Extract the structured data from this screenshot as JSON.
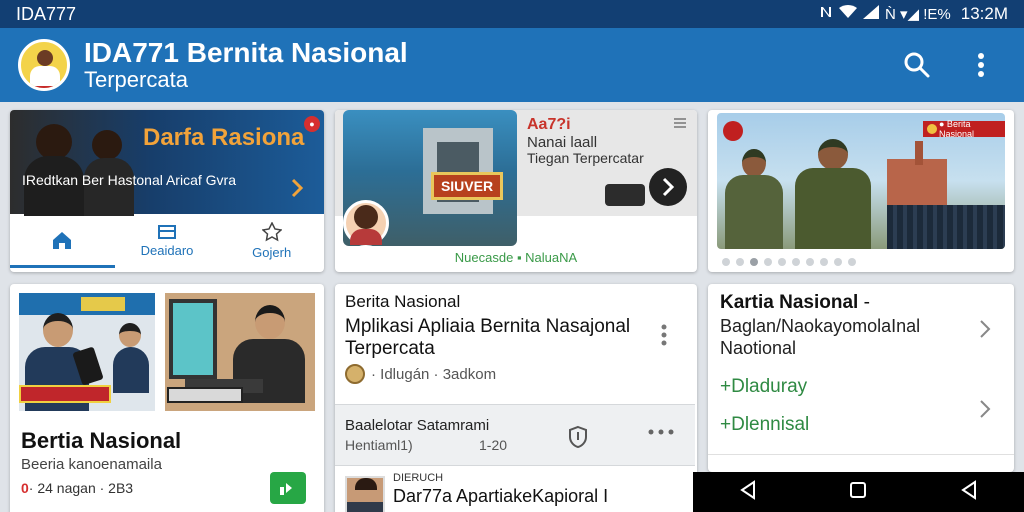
{
  "status_bar": {
    "app_name": "IDA777",
    "indicators": "Ǹ ▾◢ ǃΕ%",
    "time": "13:2M"
  },
  "app_bar": {
    "title": "IDA771 Bernita Nasional",
    "subtitle": "Terpercata",
    "icons": [
      "search-icon",
      "more-vert-icon"
    ]
  },
  "colors": {
    "appbar": "#1f72b8",
    "statusbar": "#123f73",
    "accent_green": "#27a745",
    "accent_red": "#d62f2f",
    "accent_orange": "#f2a33a"
  },
  "card1": {
    "banner_title": "Darfa Rasiona",
    "banner_text": "IRedtkan Ber Hastonal Aricaf Gvra",
    "badge": "●",
    "tabs": [
      {
        "label": "",
        "icon": "home-icon",
        "active": true
      },
      {
        "label": "Deaidaro",
        "icon": "news-icon",
        "active": false
      },
      {
        "label": "Gojerh",
        "icon": "star-icon",
        "active": false
      }
    ]
  },
  "card2": {
    "tag": "Aa7?i",
    "line1": "Nanai laall",
    "line2": "Tiegan Terpercatar",
    "sign": "SIUVER",
    "caption": "Nuecasde ▪ NaluaNA"
  },
  "card3": {
    "badge": "● Berita Nasional",
    "slides": 10,
    "active_slide": 3
  },
  "card4": {
    "title": "Bertia Nasional",
    "subtitle": "Beeria kanoenamaila",
    "meta_dot": "0",
    "meta_text": "· 24 nagan · 2B3"
  },
  "card5": {
    "kicker": "Berita Nasional",
    "title": "Mplikasi Apliaia Bernita Nasajonal Terpercata",
    "meta": "· Idlugán · 3adkom",
    "row": {
      "title": "Baalelotar Satamrami",
      "left": "Hentiaml1)",
      "right": "1-20"
    },
    "bottom": {
      "kicker": "DIERUCH",
      "title": "Dar77a ApartiakeKapioral I"
    }
  },
  "card6": {
    "title": "Kartia Nasional",
    "title_suffix": "-",
    "subtitle": "Baglan/NaokayomolaInal Naotional",
    "link1": "+Dladuray",
    "link2": "+Dlennisal"
  },
  "nav_bar": {
    "icons": [
      "back-icon",
      "home-square-icon",
      "recent-icon"
    ]
  }
}
